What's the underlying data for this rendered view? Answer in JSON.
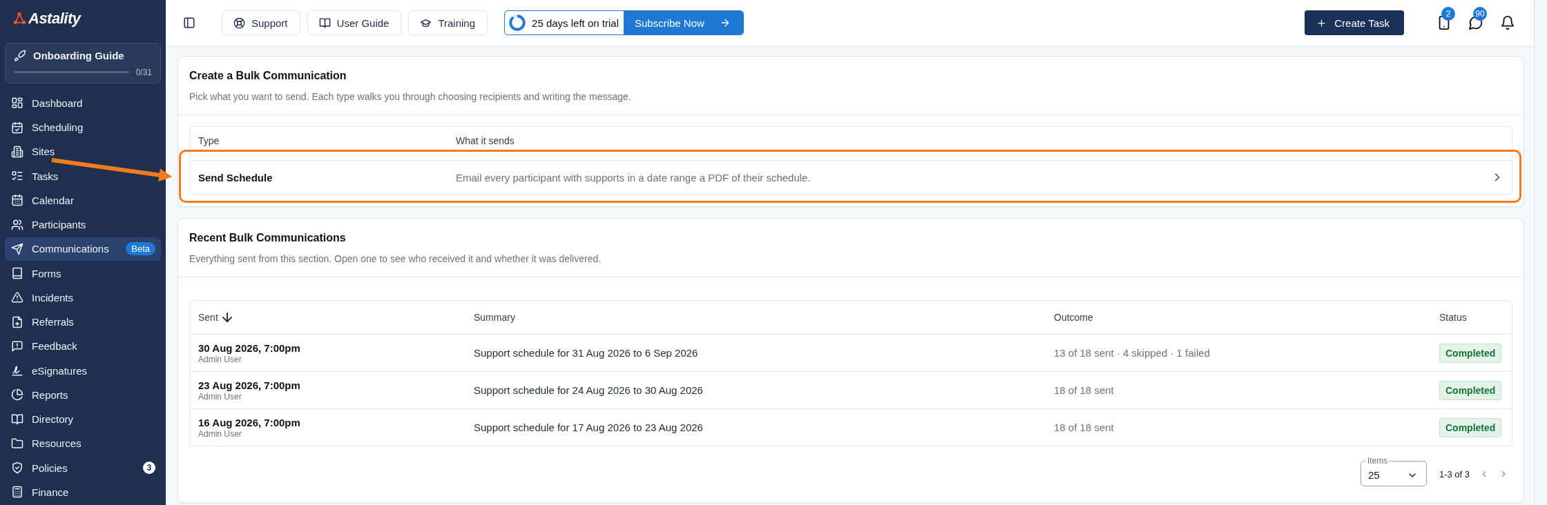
{
  "sidebar": {
    "brand": "Astality",
    "onboarding": {
      "title": "Onboarding Guide",
      "level": 0,
      "count": "0/31"
    },
    "items": [
      {
        "label": "Dashboard",
        "selected": false
      },
      {
        "label": "Scheduling",
        "selected": false
      },
      {
        "label": "Sites",
        "selected": false
      },
      {
        "label": "Tasks",
        "selected": false
      },
      {
        "label": "Calendar",
        "selected": false
      },
      {
        "label": "Participants",
        "selected": false
      },
      {
        "label": "Communications",
        "selected": true,
        "badge": {
          "kind": "pill",
          "text": "Beta"
        }
      },
      {
        "label": "Forms",
        "selected": false
      },
      {
        "label": "Incidents",
        "selected": false
      },
      {
        "label": "Referrals",
        "selected": false
      },
      {
        "label": "Feedback",
        "selected": false
      },
      {
        "label": "eSignatures",
        "selected": false
      },
      {
        "label": "Reports",
        "selected": false
      },
      {
        "label": "Directory",
        "selected": false
      },
      {
        "label": "Resources",
        "selected": false
      },
      {
        "label": "Policies",
        "selected": false,
        "badge": {
          "kind": "count",
          "text": "3"
        }
      },
      {
        "label": "Finance",
        "selected": false
      }
    ]
  },
  "top_bar": {
    "buttons": [
      "Support",
      "User Guide",
      "Training"
    ],
    "trial": {
      "text": "25 days left on trial",
      "action": "Subscribe Now"
    },
    "create_button": "Create Task",
    "notification_counts": [
      "2",
      "90"
    ]
  },
  "create_section": {
    "title": "Create a Bulk Communication",
    "subtitle": "Pick what you want to send. Each type walks you through choosing recipients and writing the message.",
    "table": {
      "columns": [
        "Type",
        "What it sends"
      ],
      "rows": [
        {
          "type": "Send Schedule",
          "description": "Email every participant with supports in a date range a PDF of their schedule.",
          "highlighted": true
        }
      ]
    }
  },
  "recent_section": {
    "title": "Recent Bulk Communications",
    "subtitle": "Everything sent from this section. Open one to see who received it and whether it was delivered.",
    "table": {
      "columns": [
        {
          "label": "Sent",
          "sorted_descending": true
        },
        {
          "label": "Summary"
        },
        {
          "label": "Outcome"
        },
        {
          "label": "Status"
        }
      ],
      "rows": [
        {
          "sent": "30 Aug 2026, 7:00pm",
          "by": "Admin User",
          "summary": "Support schedule for 31 Aug 2026 to 6 Sep 2026",
          "outcome": "13 of 18 sent · 4 skipped · 1 failed",
          "status": {
            "label": "Completed",
            "kind": "success"
          }
        },
        {
          "sent": "23 Aug 2026, 7:00pm",
          "by": "Admin User",
          "summary": "Support schedule for 24 Aug 2026 to 30 Aug 2026",
          "outcome": "18 of 18 sent",
          "status": {
            "label": "Completed",
            "kind": "success"
          }
        },
        {
          "sent": "16 Aug 2026, 7:00pm",
          "by": "Admin User",
          "summary": "Support schedule for 17 Aug 2026 to 23 Aug 2026",
          "outcome": "18 of 18 sent",
          "status": {
            "label": "Completed",
            "kind": "success"
          }
        }
      ]
    },
    "pagination": {
      "items_label": "Items",
      "items_value": "25",
      "range": "1-3 of 3"
    }
  }
}
